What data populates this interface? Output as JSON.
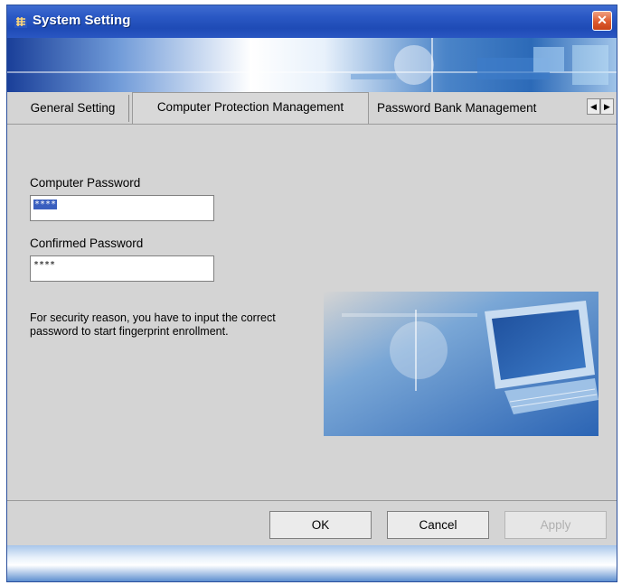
{
  "window": {
    "title": "System Setting",
    "close_glyph": "✕"
  },
  "tabs": [
    {
      "label": "General Setting",
      "active": false
    },
    {
      "label": "Computer Protection Management",
      "active": true
    },
    {
      "label": "Password Bank Management",
      "active": false
    }
  ],
  "tab_scroll": {
    "left_glyph": "◀",
    "right_glyph": "▶"
  },
  "form": {
    "computer_password_label": "Computer Password",
    "computer_password_value": "****",
    "confirmed_password_label": "Confirmed Password",
    "confirmed_password_value": "****",
    "info_text": "For security reason, you have to input the correct password to start fingerprint enrollment."
  },
  "buttons": {
    "ok": "OK",
    "cancel": "Cancel",
    "apply": "Apply"
  },
  "icons": {
    "app": "fingerprint-app-icon",
    "close": "close-icon",
    "illustration": "computer-monitor-illustration"
  },
  "colors": {
    "titlebar": "#2a58c4",
    "close_button": "#dd5a2e",
    "selection": "#3a5fbf",
    "panel": "#d4d4d4"
  }
}
